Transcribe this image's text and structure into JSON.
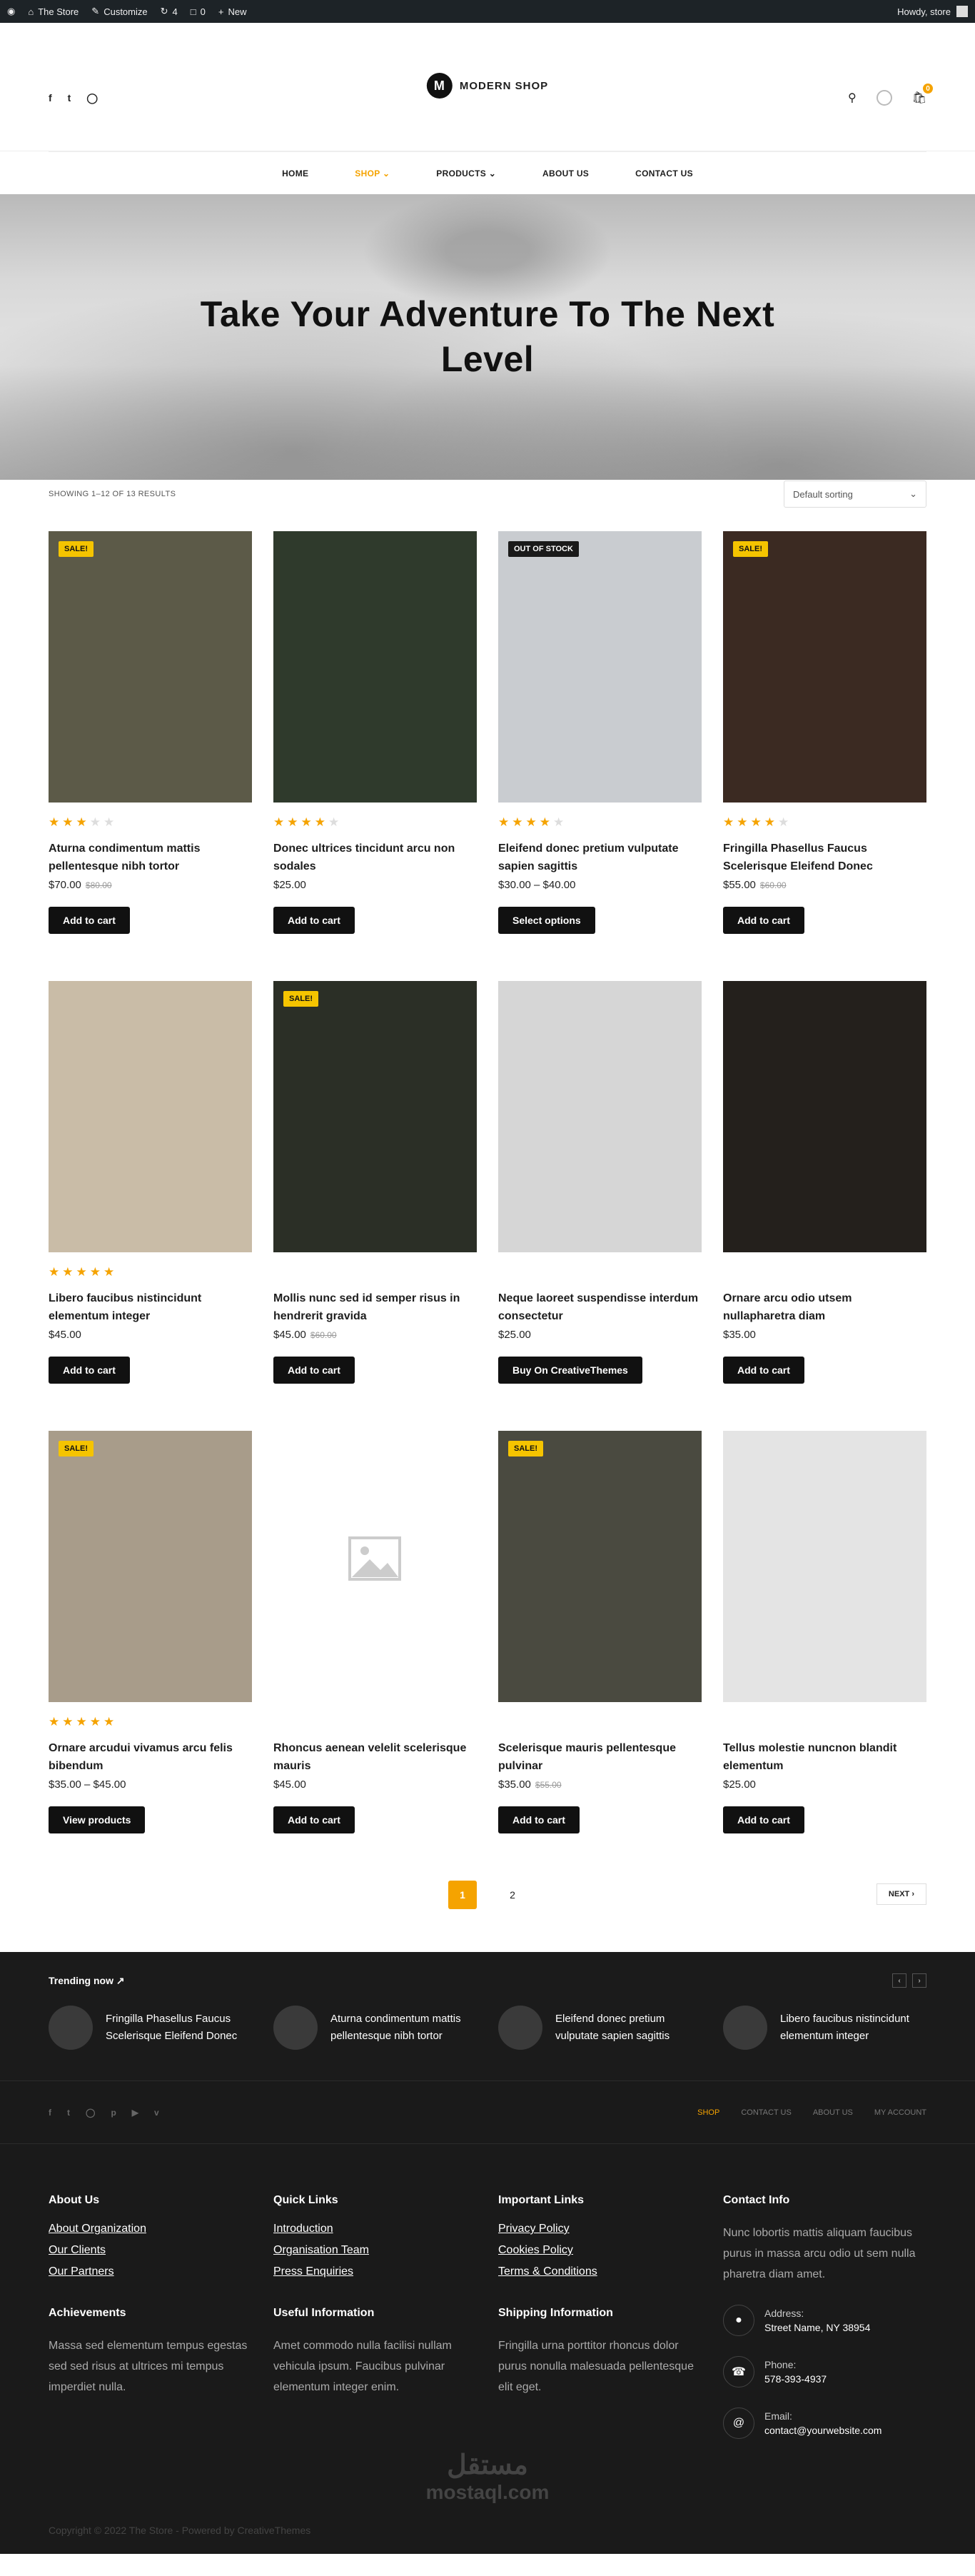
{
  "adminbar": {
    "site": "The Store",
    "customize": "Customize",
    "comments_count": "4",
    "updates_count": "0",
    "new": "New",
    "howdy": "Howdy, store"
  },
  "header": {
    "logo_letter": "M",
    "logo_text": "MODERN SHOP",
    "cart_count": "0"
  },
  "nav": [
    "HOME",
    "SHOP",
    "PRODUCTS",
    "ABOUT US",
    "CONTACT US"
  ],
  "hero": {
    "title": "Take Your Adventure To The Next Level"
  },
  "shop": {
    "result_count": "SHOWING 1–12 OF 13 RESULTS",
    "sort_label": "Default sorting"
  },
  "products": [
    {
      "name": "Aturna condimentum mattis pellentesque nibh tortor",
      "price": "$70.00",
      "old": "$80.00",
      "badge": "SALE!",
      "rating": 3,
      "button": "Add to cart",
      "bg": "#5c5a48"
    },
    {
      "name": "Donec ultrices tincidunt arcu non sodales",
      "price": "$25.00",
      "old": "",
      "badge": "",
      "rating": 4,
      "button": "Add to cart",
      "bg": "#2f3a2c"
    },
    {
      "name": "Eleifend donec pretium vulputate sapien sagittis",
      "price": "$30.00 – $40.00",
      "old": "",
      "badge": "OUT OF STOCK",
      "rating": 4,
      "button": "Select options",
      "bg": "#c9ccd0"
    },
    {
      "name": "Fringilla Phasellus Faucus Scelerisque Eleifend Donec",
      "price": "$55.00",
      "old": "$60.00",
      "badge": "SALE!",
      "rating": 4,
      "button": "Add to cart",
      "bg": "#3b2a22"
    },
    {
      "name": "Libero faucibus nistincidunt elementum integer",
      "price": "$45.00",
      "old": "",
      "badge": "",
      "rating": 5,
      "button": "Add to cart",
      "bg": "#c9bca7"
    },
    {
      "name": "Mollis nunc sed id semper risus in hendrerit gravida",
      "price": "$45.00",
      "old": "$60.00",
      "badge": "SALE!",
      "rating": 0,
      "button": "Add to cart",
      "bg": "#2b2f26"
    },
    {
      "name": "Neque laoreet suspendisse interdum consectetur",
      "price": "$25.00",
      "old": "",
      "badge": "",
      "rating": 0,
      "button": "Buy On CreativeThemes",
      "bg": "#d6d6d6"
    },
    {
      "name": "Ornare arcu odio utsem nullapharetra diam",
      "price": "$35.00",
      "old": "",
      "badge": "",
      "rating": 0,
      "button": "Add to cart",
      "bg": "#24201c"
    },
    {
      "name": "Ornare arcudui vivamus arcu felis bibendum",
      "price": "$35.00 – $45.00",
      "old": "",
      "badge": "SALE!",
      "rating": 5,
      "button": "View products",
      "bg": "#a89c8a"
    },
    {
      "name": "Rhoncus aenean velelit scelerisque mauris",
      "price": "$45.00",
      "old": "",
      "badge": "",
      "rating": 0,
      "button": "Add to cart",
      "bg": "#ffffff"
    },
    {
      "name": "Scelerisque mauris pellentesque pulvinar",
      "price": "$35.00",
      "old": "$55.00",
      "badge": "SALE!",
      "rating": 0,
      "button": "Add to cart",
      "bg": "#4a4a40"
    },
    {
      "name": "Tellus molestie nuncnon blandit elementum",
      "price": "$25.00",
      "old": "",
      "badge": "",
      "rating": 0,
      "button": "Add to cart",
      "bg": "#e4e4e4"
    }
  ],
  "pagination": {
    "pages": [
      "1",
      "2"
    ],
    "next": "NEXT"
  },
  "trending": {
    "title": "Trending now",
    "items": [
      "Fringilla Phasellus Faucus Scelerisque Eleifend Donec",
      "Aturna condimentum mattis pellentesque nibh tortor",
      "Eleifend donec pretium vulputate sapien sagittis",
      "Libero faucibus nistincidunt elementum integer"
    ]
  },
  "footer_nav": [
    "SHOP",
    "CONTACT US",
    "ABOUT US",
    "MY ACCOUNT"
  ],
  "footer": {
    "about_title": "About Us",
    "about_links": [
      "About Organization",
      "Our Clients",
      "Our Partners"
    ],
    "quick_title": "Quick Links",
    "quick_links": [
      "Introduction",
      "Organisation Team",
      "Press Enquiries"
    ],
    "important_title": "Important Links",
    "important_links": [
      "Privacy Policy",
      "Cookies Policy",
      "Terms & Conditions"
    ],
    "contact_title": "Contact Info",
    "contact_text": "Nunc lobortis mattis aliquam faucibus purus in massa arcu odio ut sem nulla pharetra diam amet.",
    "achievements_title": "Achievements",
    "achievements_text": "Massa sed elementum tempus egestas sed sed risus at ultrices mi tempus imperdiet nulla.",
    "useful_title": "Useful Information",
    "useful_text": "Amet commodo nulla facilisi nullam vehicula ipsum. Faucibus pulvinar elementum integer enim.",
    "shipping_title": "Shipping Information",
    "shipping_text": "Fringilla urna porttitor rhoncus dolor purus nonulla malesuada pellentesque elit eget.",
    "address_label": "Address:",
    "address_value": "Street Name, NY 38954",
    "phone_label": "Phone:",
    "phone_value": "578-393-4937",
    "email_label": "Email:",
    "email_value": "contact@yourwebsite.com",
    "watermark": "مستقل",
    "watermark_sub": "mostaql.com",
    "copyright": "Copyright © 2022 The Store - Powered by CreativeThemes"
  },
  "colors": {
    "accent": "#f5a300",
    "sale_badge": "#f5c400",
    "dark": "#1a1a1a"
  }
}
